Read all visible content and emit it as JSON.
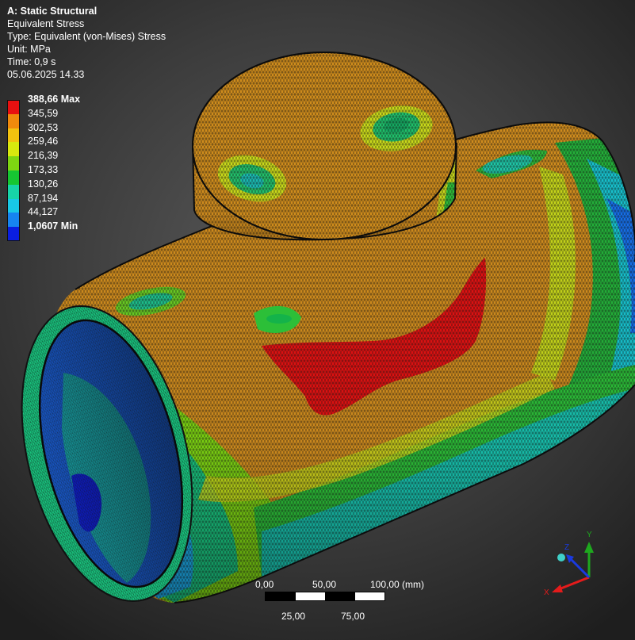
{
  "info": {
    "title": "A: Static Structural",
    "result_name": "Equivalent Stress",
    "type": "Type: Equivalent (von-Mises) Stress",
    "unit": "Unit: MPa",
    "time": "Time: 0,9 s",
    "date": "05.06.2025 14.33"
  },
  "legend": {
    "items": [
      {
        "label": "388,66 Max",
        "color": "#e81010",
        "bold": true
      },
      {
        "label": "345,59",
        "color": "#f08a0c",
        "bold": false
      },
      {
        "label": "302,53",
        "color": "#f2c20f",
        "bold": false
      },
      {
        "label": "259,46",
        "color": "#d8e80e",
        "bold": false
      },
      {
        "label": "216,39",
        "color": "#7ed612",
        "bold": false
      },
      {
        "label": "173,33",
        "color": "#16c632",
        "bold": false
      },
      {
        "label": "130,26",
        "color": "#17d4a8",
        "bold": false
      },
      {
        "label": "87,194",
        "color": "#18c8e6",
        "bold": false
      },
      {
        "label": "44,127",
        "color": "#1684f0",
        "bold": false
      },
      {
        "label": "1,0607 Min",
        "color": "#0a1ee0",
        "bold": true
      }
    ]
  },
  "scale": {
    "top_labels": [
      "0,00",
      "50,00",
      "100,00 (mm)"
    ],
    "bottom_labels": [
      "25,00",
      "75,00"
    ]
  },
  "triad": {
    "x": "X",
    "y": "Y",
    "z": "Z"
  },
  "colors": {
    "max_red": "#e81010",
    "orange": "#d9901c",
    "green": "#22c036",
    "blue": "#1684f0",
    "axis_x": "#e41b1b",
    "axis_y": "#1ea81e",
    "axis_z": "#1a3adf",
    "triad_center": "#3fd0c8"
  }
}
